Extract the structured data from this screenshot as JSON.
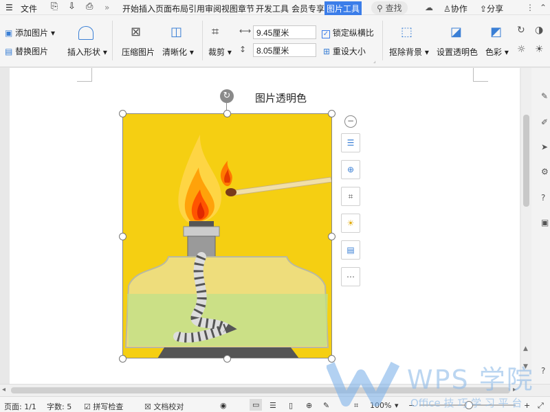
{
  "menubar": {
    "file_label": "文件",
    "tabs": [
      "开始",
      "插入",
      "页面布局",
      "引用",
      "审阅",
      "视图",
      "章节",
      "开发工具",
      "会员专享"
    ],
    "active_tab": "图片工具",
    "search_label": "查找",
    "collab_label": "协作",
    "share_label": "分享"
  },
  "ribbon": {
    "add_picture": "添加图片",
    "replace_picture": "替换图片",
    "insert_shape": "插入形状",
    "compress_picture": "压缩图片",
    "sharpen": "清晰化",
    "crop": "裁剪",
    "width_value": "9.45厘米",
    "height_value": "8.05厘米",
    "lock_ratio": "锁定纵横比",
    "reset_size": "重设大小",
    "remove_background": "抠除背景",
    "set_transparent": "设置透明色",
    "color": "色彩"
  },
  "document": {
    "tooltip": "图片透明色"
  },
  "statusbar": {
    "page": "页面: 1/1",
    "word_count": "字数: 5",
    "spell_check": "拼写检查",
    "doc_proof": "文档校对",
    "zoom": "100%"
  },
  "watermark": {
    "brand": "WPS 学院",
    "sub": "Office 技 巧 学 习 平 台"
  },
  "colors": {
    "image_bg": "#f5cf12",
    "active_tab_bg": "#3b7de9",
    "accent": "#3b7de9"
  }
}
